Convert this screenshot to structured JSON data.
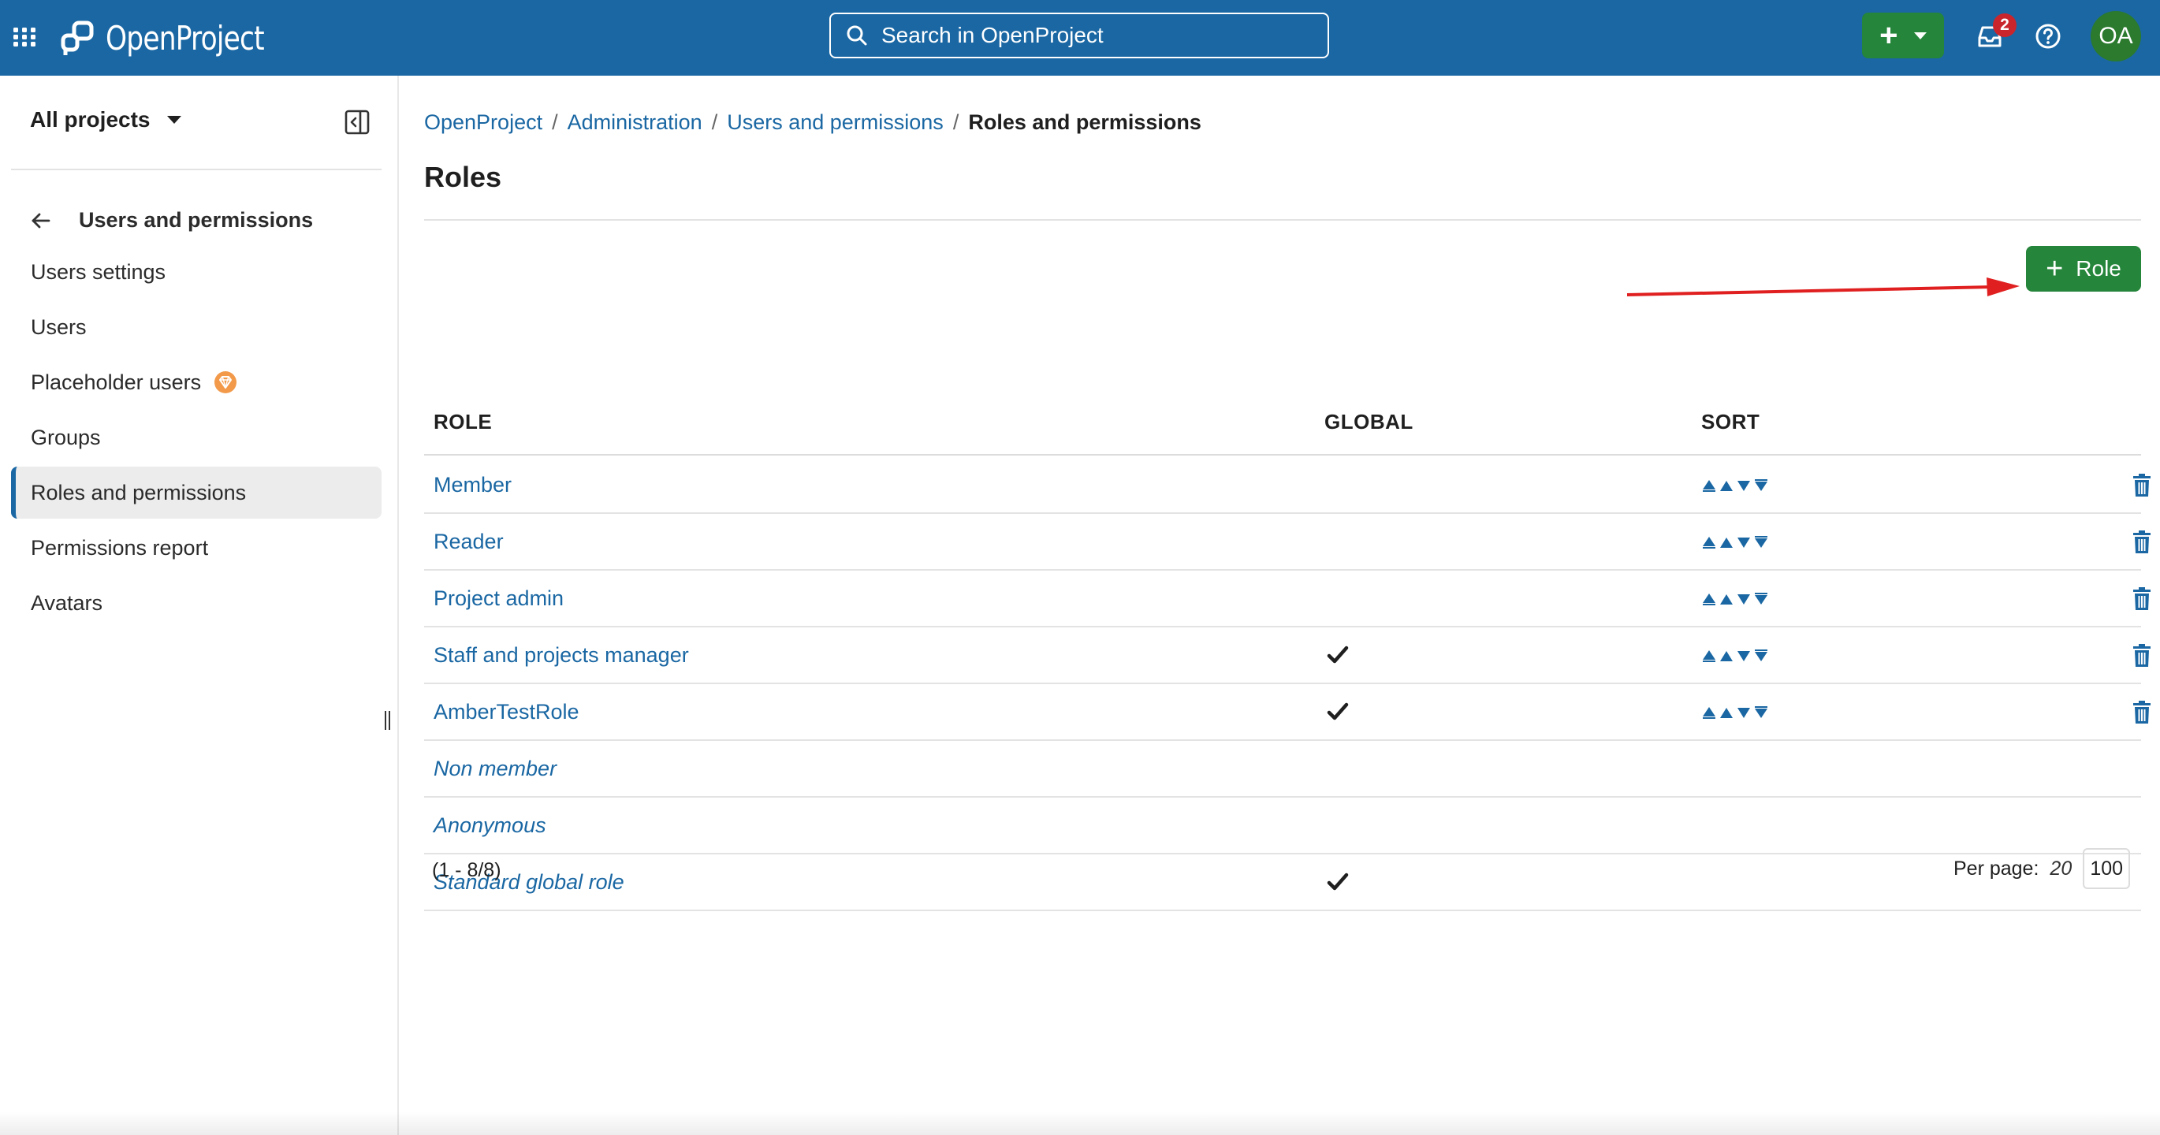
{
  "header": {
    "logo_text": "OpenProject",
    "search_placeholder": "Search in OpenProject",
    "notification_count": "2",
    "avatar_initials": "OA",
    "colors": {
      "header_bg": "#1a67a3",
      "create_bg": "#25853a",
      "badge_bg": "#c9252d",
      "avatar_bg": "#2b7a2e"
    }
  },
  "sidebar": {
    "project_selector": "All projects",
    "back_label": "Users and permissions",
    "items": [
      {
        "label": "Users settings",
        "active": false
      },
      {
        "label": "Users",
        "active": false
      },
      {
        "label": "Placeholder users",
        "active": false,
        "enterprise_icon": "enterprise-badge-icon"
      },
      {
        "label": "Groups",
        "active": false
      },
      {
        "label": "Roles and permissions",
        "active": true
      },
      {
        "label": "Permissions report",
        "active": false
      },
      {
        "label": "Avatars",
        "active": false
      }
    ]
  },
  "breadcrumb": {
    "items": [
      "OpenProject",
      "Administration",
      "Users and permissions"
    ],
    "current": "Roles and permissions",
    "separator": "/"
  },
  "page": {
    "title": "Roles",
    "add_button_label": "Role",
    "add_button_icon": "plus-icon"
  },
  "table": {
    "headers": {
      "role": "ROLE",
      "global": "GLOBAL",
      "sort": "SORT"
    },
    "rows": [
      {
        "name": "Member",
        "global": false,
        "builtin": false,
        "sortable": true,
        "deletable": true
      },
      {
        "name": "Reader",
        "global": false,
        "builtin": false,
        "sortable": true,
        "deletable": true
      },
      {
        "name": "Project admin",
        "global": false,
        "builtin": false,
        "sortable": true,
        "deletable": true
      },
      {
        "name": "Staff and projects manager",
        "global": true,
        "builtin": false,
        "sortable": true,
        "deletable": true
      },
      {
        "name": "AmberTestRole",
        "global": true,
        "builtin": false,
        "sortable": true,
        "deletable": true
      },
      {
        "name": "Non member",
        "global": false,
        "builtin": true,
        "sortable": false,
        "deletable": false
      },
      {
        "name": "Anonymous",
        "global": false,
        "builtin": true,
        "sortable": false,
        "deletable": false
      },
      {
        "name": "Standard global role",
        "global": true,
        "builtin": true,
        "sortable": false,
        "deletable": false
      }
    ]
  },
  "pagination": {
    "range": "(1 - 8/8)",
    "per_page_label": "Per page:",
    "per_page_current": "20",
    "per_page_option": "100"
  },
  "annotation": {
    "arrow_color": "#e02020"
  }
}
